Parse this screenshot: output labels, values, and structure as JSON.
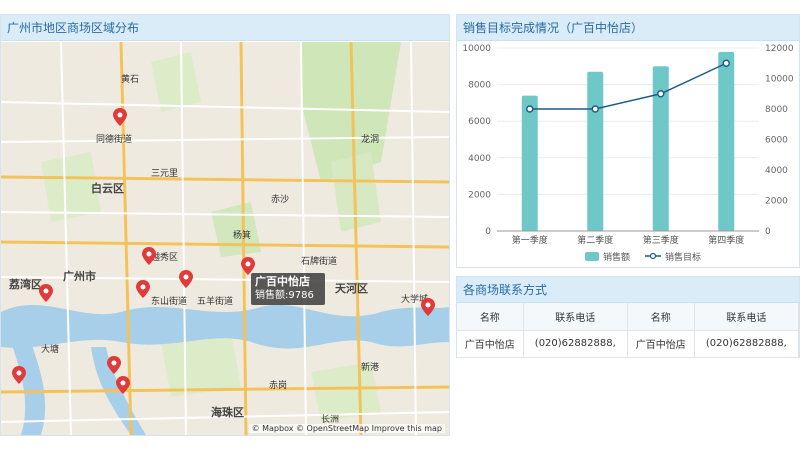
{
  "map_panel": {
    "title": "广州市地区商场区域分布",
    "tooltip": {
      "name": "广百中怡店",
      "sales_text": "销售额:9786"
    },
    "attribution": "© Mapbox © OpenStreetMap Improve this map",
    "labels": [
      "白云区",
      "广州市",
      "荔湾区",
      "天河区",
      "海珠区",
      "越秀区",
      "东山街道",
      "五羊街道",
      "赤岗",
      "新港",
      "杨箕",
      "大学城",
      "石牌街道",
      "同德街道",
      "大塘",
      "三元里",
      "黄石",
      "长洲",
      "赤沙",
      "龙洞"
    ],
    "store_pin_count": 10
  },
  "chart_panel": {
    "title": "销售目标完成情况（广百中怡店）",
    "legend": {
      "sales": "销售额",
      "target": "销售目标"
    }
  },
  "chart_data": {
    "type": "bar",
    "categories": [
      "第一季度",
      "第二季度",
      "第三季度",
      "第四季度"
    ],
    "series": [
      {
        "name": "销售额",
        "type": "bar",
        "axis": "left",
        "values": [
          7400,
          8700,
          9000,
          9786
        ],
        "color": "#6fc8c8"
      },
      {
        "name": "销售目标",
        "type": "line",
        "axis": "right",
        "values": [
          8000,
          8000,
          9000,
          11000
        ],
        "color": "#1f5a86"
      }
    ],
    "y_left": {
      "min": 0,
      "max": 10000,
      "ticks": [
        0,
        2000,
        4000,
        6000,
        8000,
        10000
      ]
    },
    "y_right": {
      "min": 0,
      "max": 12000,
      "ticks": [
        0,
        2000,
        4000,
        6000,
        8000,
        10000,
        12000
      ]
    },
    "grid": true,
    "legend_position": "bottom"
  },
  "contacts_panel": {
    "title": "各商场联系方式",
    "headers": [
      "名称",
      "联系电话",
      "名称",
      "联系电话"
    ],
    "rows": [
      [
        "广百中怡店",
        "(020)62882888,",
        "广百中怡店",
        "(020)62882888,"
      ]
    ]
  },
  "colors": {
    "header_bg": "#d9ecf8",
    "header_text": "#2a6aa3",
    "pin": "#e03a3a",
    "bar": "#6fc8c8",
    "line": "#1f5a86"
  }
}
